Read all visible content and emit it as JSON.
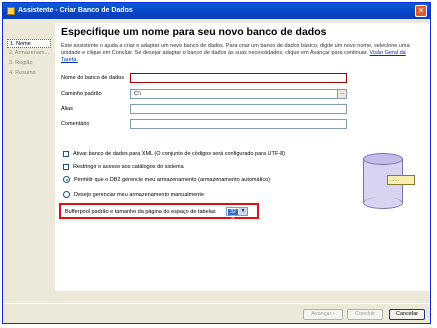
{
  "window": {
    "title": "Assistente - Criar Banco de Dados",
    "close_symbol": "✕"
  },
  "nav": {
    "items": [
      {
        "label": "1. Nome",
        "active": true
      },
      {
        "label": "2. Armazenam...",
        "active": false
      },
      {
        "label": "3. Região",
        "active": false
      },
      {
        "label": "4. Resumo",
        "active": false
      }
    ]
  },
  "main": {
    "heading": "Especifique um nome para seu novo banco de dados",
    "intro": "Este assistente o ajuda a criar e adaptar um novo banco de dados. Para criar um banco de dados básico, digite um novo nome, selecione uma unidade e clique em Concluir. Se desejar adaptar o banco de dados às suas necessidades, clique em Avançar para continuar.",
    "intro_link": "Visão Geral da Tarefa."
  },
  "form": {
    "db_name_label": "Nome do banco de dados",
    "db_name_value": "",
    "default_path_label": "Caminho padrão",
    "default_path_value": "C:\\",
    "browse_symbol": "...",
    "alias_label": "Alias",
    "alias_value": "",
    "comment_label": "Comentário",
    "comment_value": ""
  },
  "options": {
    "xml_checkbox": "Ativar banco de dados para XML (O conjunto de códigos será configurado para UTF-8)",
    "restrict_checkbox": "Restringir o acesso aos catálogos do sistema",
    "radio_auto": "Permitir que o DB2 gerencie meu armazenamento (armazenamento automático)",
    "radio_manual": "Desejo gerenciar meu armazenamento manualmente",
    "bufferpool_label": "Bufferpool padrão e tamanho da página do espaço de tabelas",
    "bufferpool_value": "32 K"
  },
  "footer": {
    "next_label": "Avançar ›",
    "finish_label": "Concluir",
    "cancel_label": "Cancelar"
  },
  "colors": {
    "title_bar": "#0843c6",
    "highlight_border": "#e01010",
    "link": "#0033aa"
  }
}
